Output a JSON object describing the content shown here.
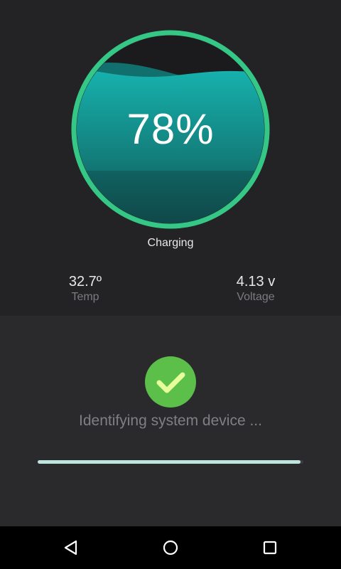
{
  "battery": {
    "level_text": "78%",
    "level_fraction": 0.78,
    "status": "Charging"
  },
  "stats": {
    "temp": {
      "value": "32.7º",
      "label": "Temp"
    },
    "voltage": {
      "value": "4.13 v",
      "label": "Voltage"
    }
  },
  "scan": {
    "icon": "check-icon",
    "message": "Identifying system device ...",
    "progress_fraction": 0.99
  },
  "navbar": {
    "back_icon": "back-triangle-icon",
    "home_icon": "home-circle-icon",
    "recent_icon": "recent-apps-square-icon"
  },
  "colors": {
    "ring": "#34c785",
    "liquid_top": "#17b4b0",
    "liquid_bottom": "#114d4c",
    "check_bg": "#5cbf4a",
    "check_mark": "#e6ff9a",
    "progress": "#bfe3dd"
  }
}
